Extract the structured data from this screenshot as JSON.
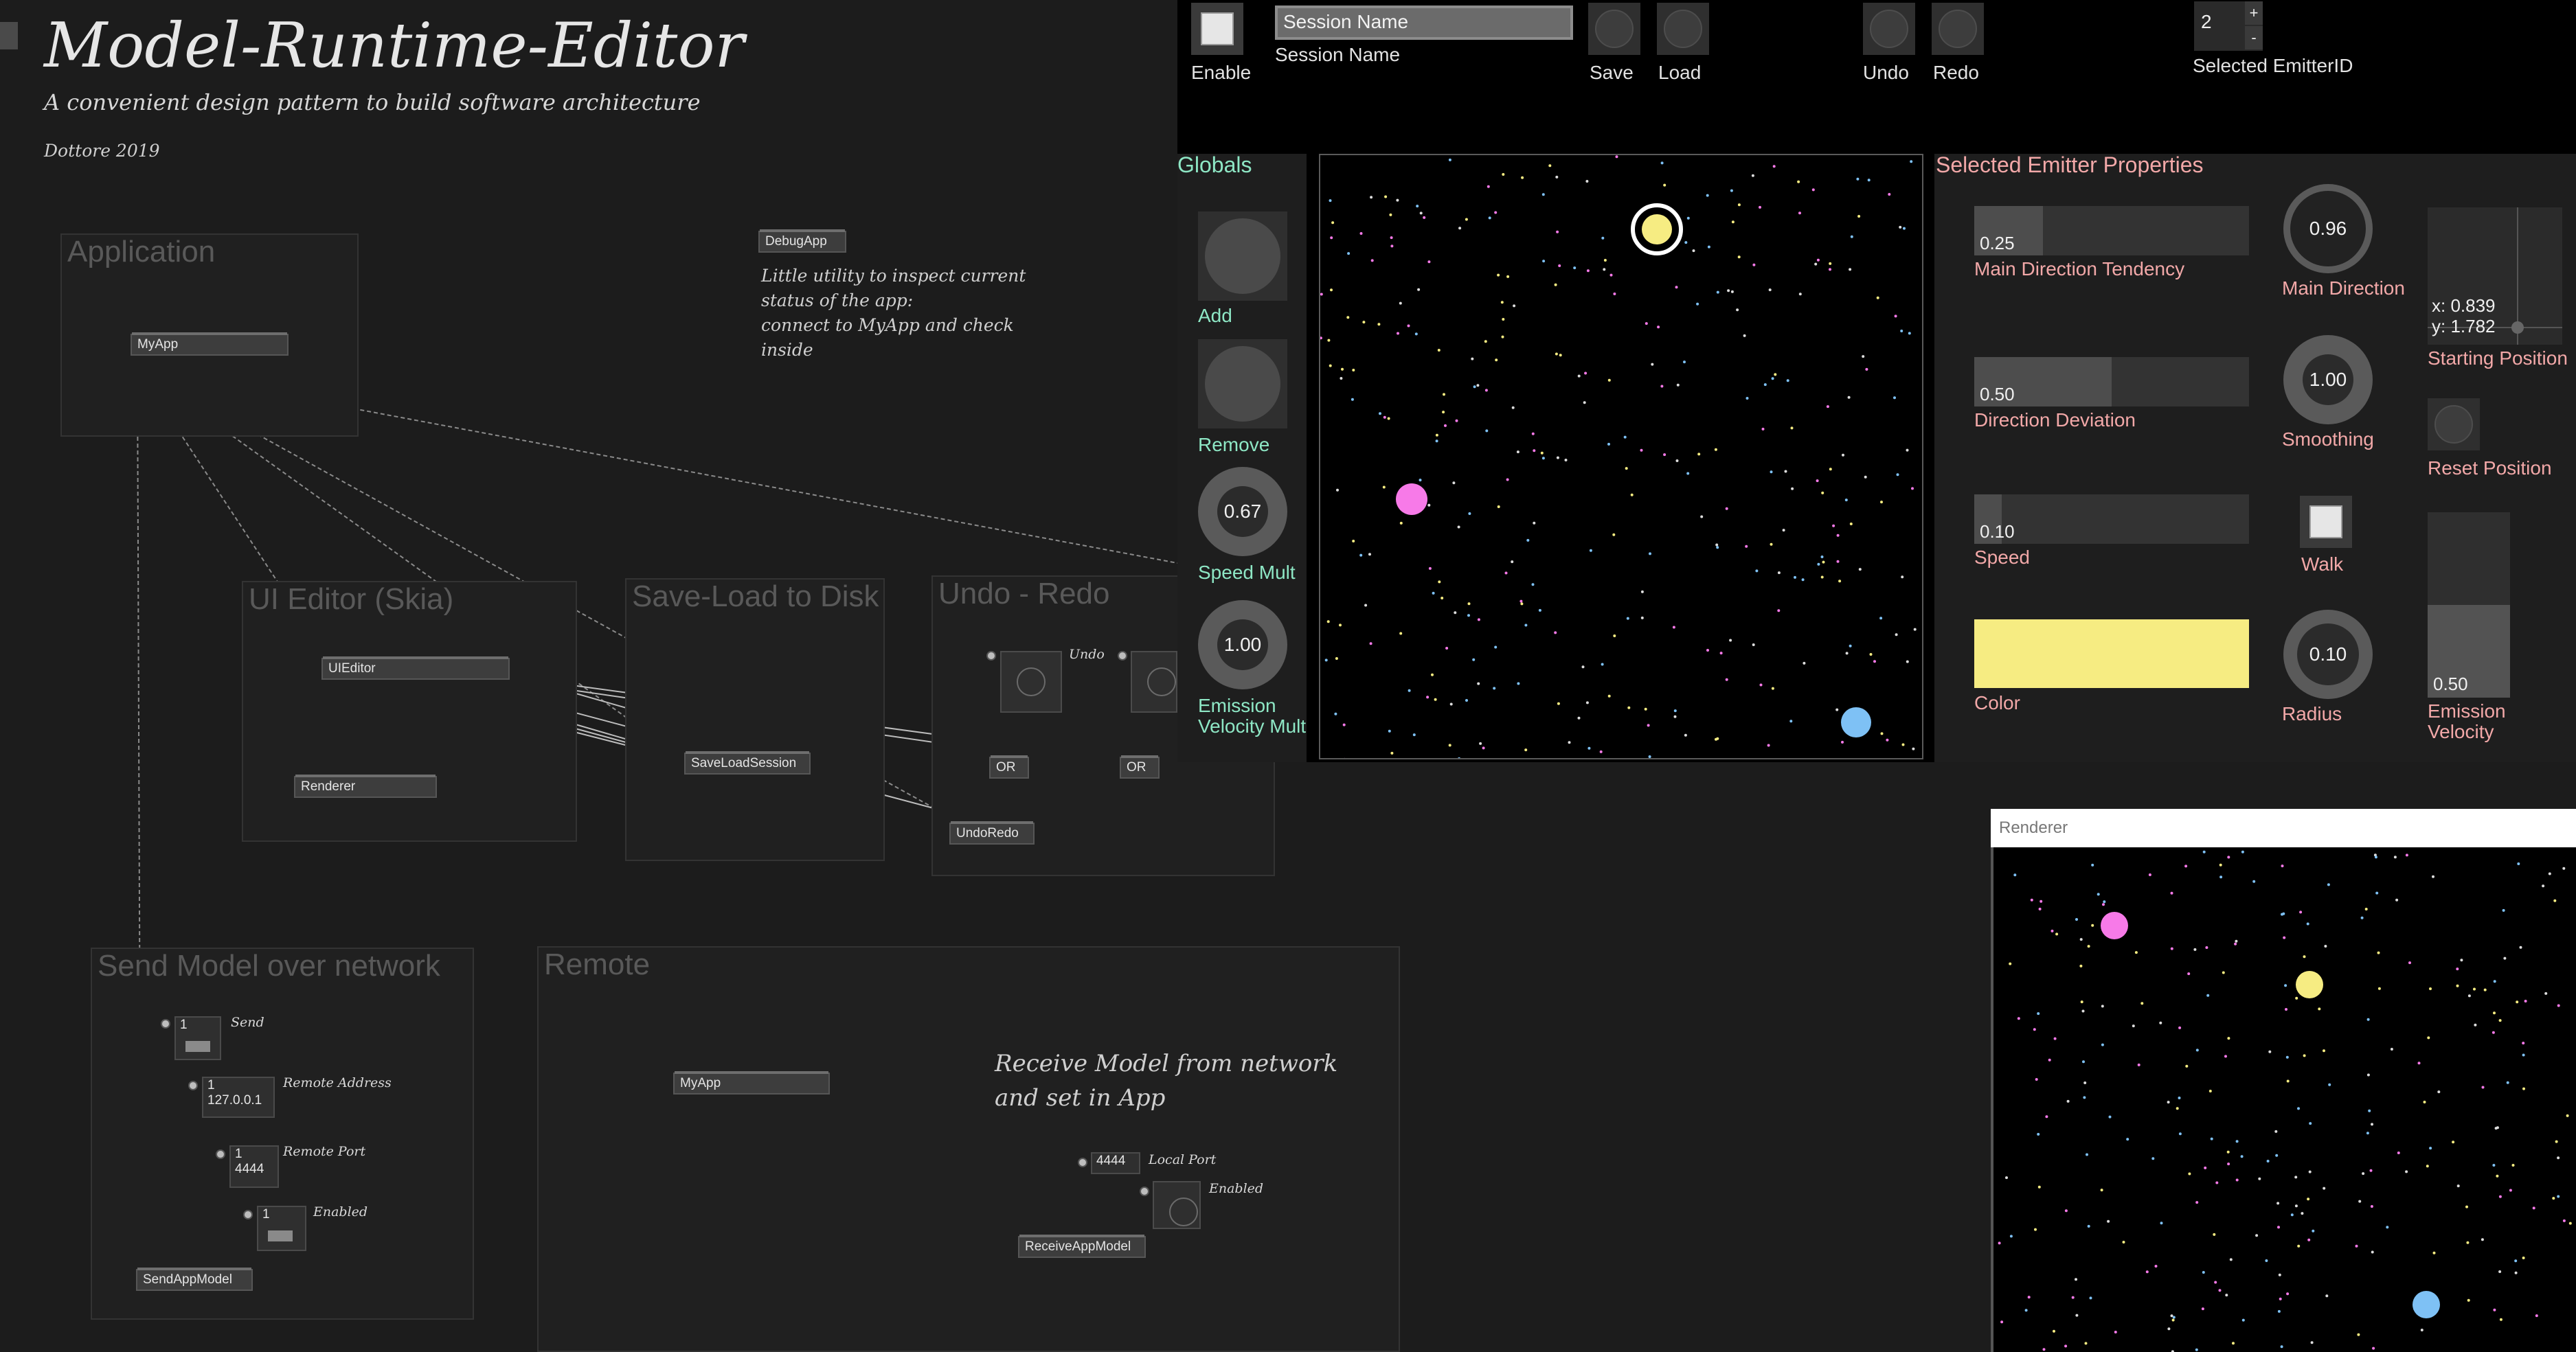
{
  "patch": {
    "title": "Model-Runtime-Editor",
    "subtitle": "A convenient design pattern to build software architecture",
    "author": "Dottore 2019",
    "groups": {
      "application": {
        "title": "Application",
        "node": "MyApp"
      },
      "ui_editor": {
        "title": "UI Editor (Skia)",
        "node_editor": "UIEditor",
        "node_renderer": "Renderer"
      },
      "save_load": {
        "title": "Save-Load to Disk",
        "node": "SaveLoadSession"
      },
      "undo_redo": {
        "title": "Undo - Redo",
        "undo_label": "Undo",
        "or1": "OR",
        "or2": "OR",
        "node": "UndoRedo"
      },
      "send": {
        "title": "Send Model over network",
        "send_label": "Send",
        "send_count": "1",
        "address_label": "Remote Address",
        "address_count": "1",
        "address_value": "127.0.0.1",
        "port_label": "Remote Port",
        "port_count": "1",
        "port_value": "4444",
        "enabled_label": "Enabled",
        "enabled_count": "1",
        "node": "SendAppModel"
      },
      "remote": {
        "title": "Remote",
        "node_app": "MyApp",
        "comment_line1": "Receive Model from network",
        "comment_line2": "and set in App",
        "port_value": "4444",
        "port_label": "Local Port",
        "enabled_label": "Enabled",
        "node": "ReceiveAppModel"
      }
    },
    "debug": {
      "node": "DebugApp",
      "lines": [
        "Little utility to inspect current",
        "status of the app:",
        "connect to MyApp and check",
        "inside"
      ]
    }
  },
  "runtime_ui": {
    "top_bar": {
      "enable_label": "Enable",
      "session_name_value": "Session Name",
      "session_name_label": "Session Name",
      "save_label": "Save",
      "load_label": "Load",
      "undo_label": "Undo",
      "redo_label": "Redo",
      "emitter_id_value": "2",
      "emitter_plus": "+",
      "emitter_minus": "-",
      "emitter_id_label": "Selected EmitterID"
    },
    "globals": {
      "title": "Globals",
      "add_label": "Add",
      "remove_label": "Remove",
      "speed_mult_value": "0.67",
      "speed_mult_label": "Speed Mult",
      "emission_mult_value": "1.00",
      "emission_mult_label_1": "Emission",
      "emission_mult_label_2": "Velocity Mult"
    },
    "emitter": {
      "title": "Selected Emitter Properties",
      "main_direction_tendency_value": "0.25",
      "main_direction_tendency_fraction": 0.25,
      "main_direction_tendency_label": "Main Direction Tendency",
      "direction_deviation_value": "0.50",
      "direction_deviation_fraction": 0.5,
      "direction_deviation_label": "Direction Deviation",
      "speed_value": "0.10",
      "speed_fraction": 0.1,
      "speed_label": "Speed",
      "color_label": "Color",
      "color_hex": "#f6ec82",
      "main_direction_value": "0.96",
      "main_direction_label": "Main Direction",
      "smoothing_value": "1.00",
      "smoothing_label": "Smoothing",
      "walk_label": "Walk",
      "radius_value": "0.10",
      "radius_label": "Radius",
      "start_x": "x: 0.839",
      "start_y": "y: 1.782",
      "starting_position_label": "Starting Position",
      "reset_position_label": "Reset Position",
      "emission_velocity_value": "0.50",
      "emission_velocity_fraction": 0.5,
      "emission_velocity_label_1": "Emission",
      "emission_velocity_label_2": "Velocity"
    },
    "emitters": [
      {
        "name": "pink",
        "color": "#f77ae8"
      },
      {
        "name": "yellow",
        "color": "#f6ec82",
        "selected": true
      },
      {
        "name": "blue",
        "color": "#7ec1f5"
      }
    ]
  },
  "renderer_window": {
    "title": "Renderer"
  }
}
